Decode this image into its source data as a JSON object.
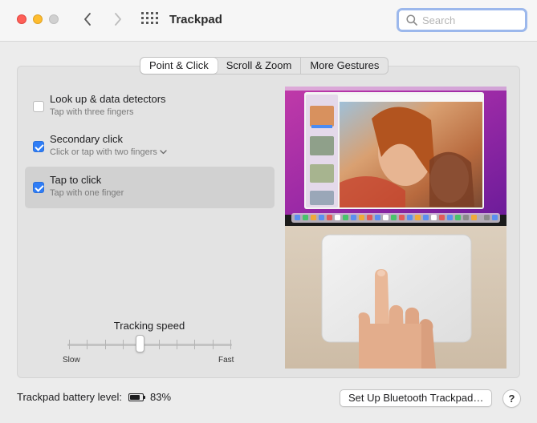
{
  "window": {
    "title": "Trackpad"
  },
  "search": {
    "placeholder": "Search"
  },
  "tabs": [
    {
      "label": "Point & Click",
      "active": true
    },
    {
      "label": "Scroll & Zoom",
      "active": false
    },
    {
      "label": "More Gestures",
      "active": false
    }
  ],
  "options": [
    {
      "title": "Look up & data detectors",
      "subtitle": "Tap with three fingers",
      "checked": false,
      "selected": false,
      "has_dropdown": false
    },
    {
      "title": "Secondary click",
      "subtitle": "Click or tap with two fingers",
      "checked": true,
      "selected": false,
      "has_dropdown": true
    },
    {
      "title": "Tap to click",
      "subtitle": "Tap with one finger",
      "checked": true,
      "selected": true,
      "has_dropdown": false
    }
  ],
  "tracking": {
    "label": "Tracking speed",
    "min_label": "Slow",
    "max_label": "Fast",
    "ticks": 10,
    "value_fraction": 0.44
  },
  "footer": {
    "battery_label": "Trackpad battery level:",
    "battery_value": "83%",
    "battery_fraction": 0.83,
    "setup_button": "Set Up Bluetooth Trackpad…",
    "help_button": "?"
  },
  "colors": {
    "accent": "#2f7df6",
    "close": "#fe5f57",
    "minimize": "#febc2e"
  }
}
